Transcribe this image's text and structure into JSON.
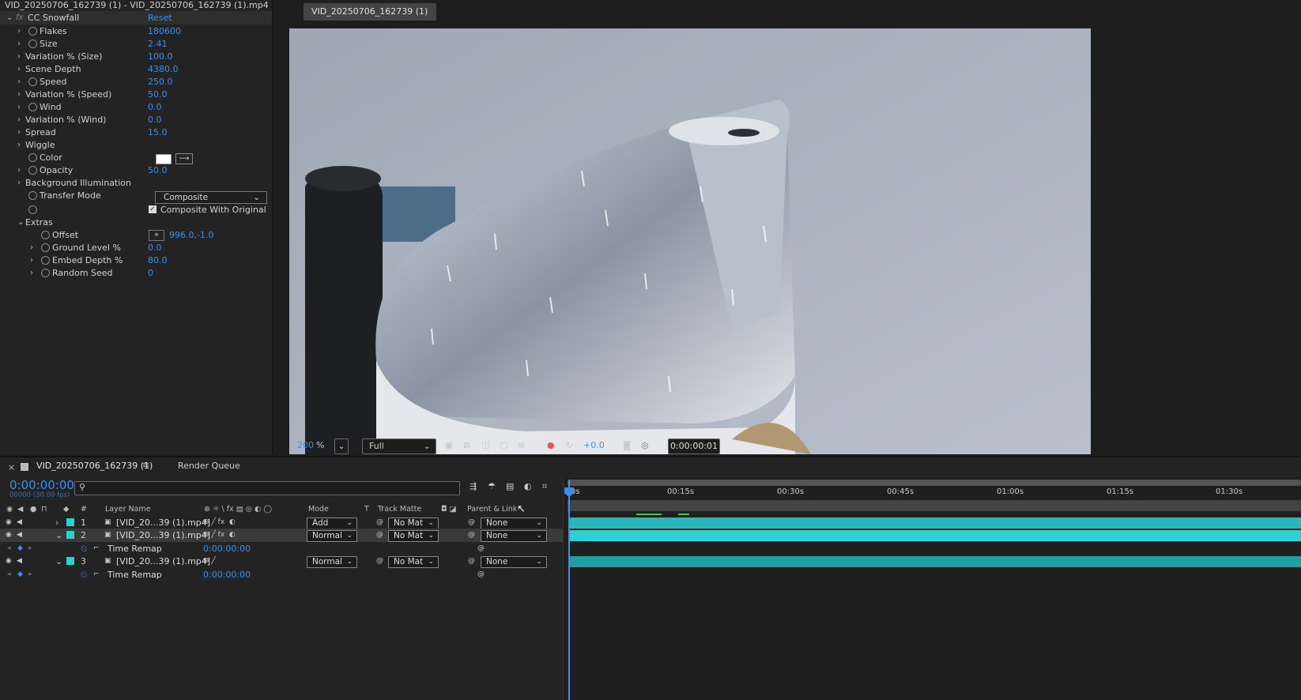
{
  "effects": {
    "title": "VID_20250706_162739 (1) - VID_20250706_162739 (1).mp4",
    "effect_name": "CC Snowfall",
    "reset_label": "Reset",
    "params": [
      {
        "name": "Flakes",
        "value": "180600"
      },
      {
        "name": "Size",
        "value": "2.41"
      },
      {
        "name": "Variation % (Size)",
        "value": "100.0"
      },
      {
        "name": "Scene Depth",
        "value": "4380.0"
      },
      {
        "name": "Speed",
        "value": "250.0"
      },
      {
        "name": "Variation % (Speed)",
        "value": "50.0"
      },
      {
        "name": "Wind",
        "value": "0.0"
      },
      {
        "name": "Variation % (Wind)",
        "value": "0.0"
      },
      {
        "name": "Spread",
        "value": "15.0"
      },
      {
        "name": "Wiggle",
        "value": ""
      },
      {
        "name": "Color",
        "value": ""
      },
      {
        "name": "Opacity",
        "value": "50.0"
      },
      {
        "name": "Background Illumination",
        "value": ""
      },
      {
        "name": "Transfer Mode",
        "value": "Composite"
      },
      {
        "name": "",
        "value": "Composite With Original"
      },
      {
        "name": "Extras",
        "value": ""
      },
      {
        "name": "Offset",
        "value": "996.0,-1.0"
      },
      {
        "name": "Ground Level %",
        "value": "0.0"
      },
      {
        "name": "Embed Depth %",
        "value": "80.0"
      },
      {
        "name": "Random Seed",
        "value": "0"
      }
    ],
    "color_value": "#ffffff"
  },
  "viewer": {
    "tab": "VID_20250706_162739 (1)",
    "zoom": "200",
    "zoom_unit": "%",
    "resolution": "Full",
    "exposure": "+0.0",
    "timecode": "0:00:00:01"
  },
  "timeline": {
    "tab": "VID_20250706_162739 (1)",
    "render_queue": "Render Queue",
    "current_time": "0:00:00:00",
    "frame_info": "00000 (30.00 fps)",
    "search_placeholder": "",
    "col_num": "#",
    "col_layer": "Layer Name",
    "col_mode": "Mode",
    "col_t": "T",
    "col_matte": "Track Matte",
    "col_parent": "Parent & Link",
    "ruler": [
      "0s",
      "00:15s",
      "00:30s",
      "00:45s",
      "01:00s",
      "01:15s",
      "01:30s"
    ],
    "layers": [
      {
        "num": "1",
        "name": "[VID_20...39 (1).mp4]",
        "mode": "Add",
        "matte": "No Mat",
        "parent": "None"
      },
      {
        "num": "2",
        "name": "[VID_20...39 (1).mp4]",
        "mode": "Normal",
        "matte": "No Mat",
        "parent": "None"
      },
      {
        "num": "3",
        "name": "[VID_20...39 (1).mp4]",
        "mode": "Normal",
        "matte": "No Mat",
        "parent": "None"
      }
    ],
    "sub_label": "Time Remap",
    "sub_value": "0:00:00:00",
    "accent": "#2ad3d3"
  }
}
